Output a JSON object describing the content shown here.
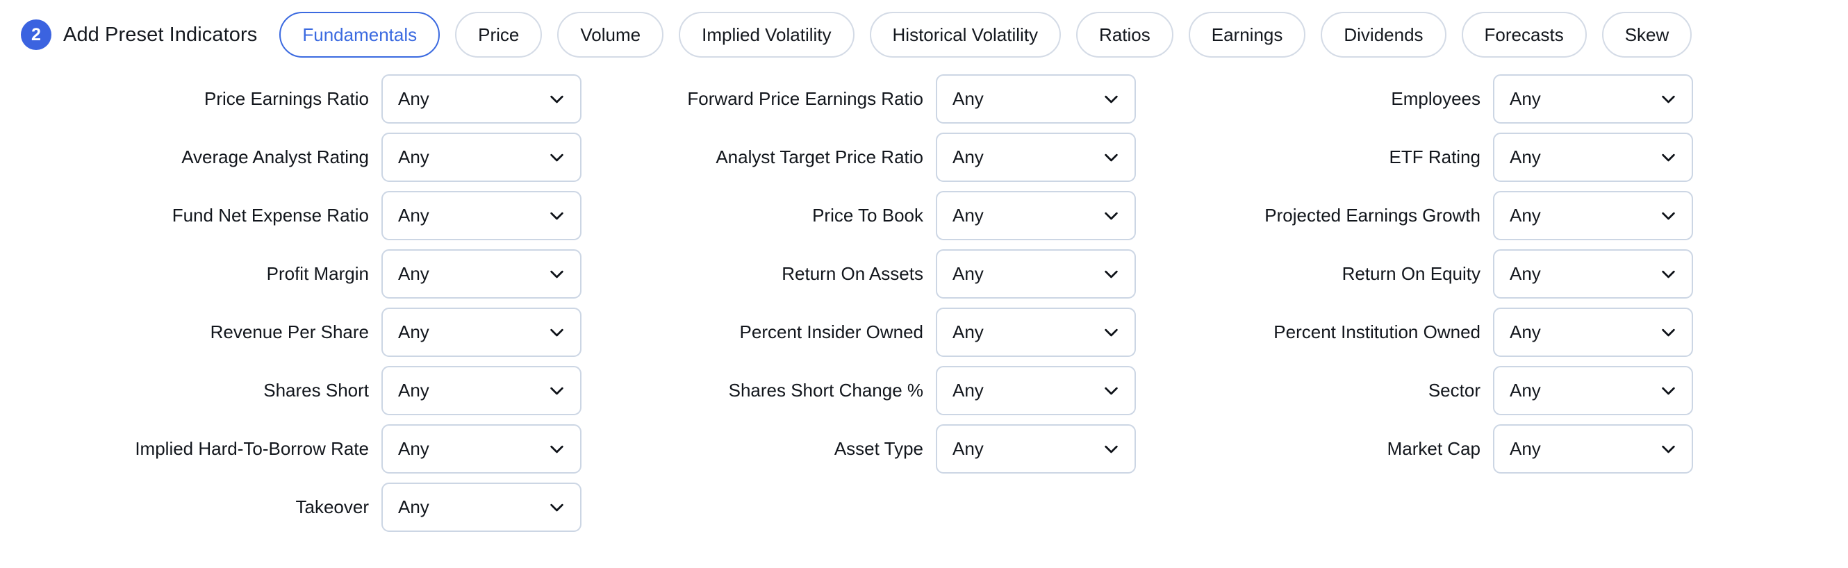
{
  "header": {
    "step_number": "2",
    "title": "Add Preset Indicators",
    "accent_color": "#3b63e0",
    "active_tab_color": "#3b6ae0",
    "tabs": [
      {
        "label": "Fundamentals",
        "active": true
      },
      {
        "label": "Price",
        "active": false
      },
      {
        "label": "Volume",
        "active": false
      },
      {
        "label": "Implied Volatility",
        "active": false
      },
      {
        "label": "Historical Volatility",
        "active": false
      },
      {
        "label": "Ratios",
        "active": false
      },
      {
        "label": "Earnings",
        "active": false
      },
      {
        "label": "Dividends",
        "active": false
      },
      {
        "label": "Forecasts",
        "active": false
      },
      {
        "label": "Skew",
        "active": false
      }
    ]
  },
  "filters": {
    "default_value": "Any",
    "columns": [
      {
        "rows": [
          {
            "label": "Price Earnings Ratio",
            "value": "Any"
          },
          {
            "label": "Average Analyst Rating",
            "value": "Any"
          },
          {
            "label": "Fund Net Expense Ratio",
            "value": "Any"
          },
          {
            "label": "Profit Margin",
            "value": "Any"
          },
          {
            "label": "Revenue Per Share",
            "value": "Any"
          },
          {
            "label": "Shares Short",
            "value": "Any"
          },
          {
            "label": "Implied Hard-To-Borrow Rate",
            "value": "Any"
          },
          {
            "label": "Takeover",
            "value": "Any"
          }
        ]
      },
      {
        "rows": [
          {
            "label": "Forward Price Earnings Ratio",
            "value": "Any"
          },
          {
            "label": "Analyst Target Price Ratio",
            "value": "Any"
          },
          {
            "label": "Price To Book",
            "value": "Any"
          },
          {
            "label": "Return On Assets",
            "value": "Any"
          },
          {
            "label": "Percent Insider Owned",
            "value": "Any"
          },
          {
            "label": "Shares Short Change %",
            "value": "Any"
          },
          {
            "label": "Asset Type",
            "value": "Any"
          }
        ]
      },
      {
        "rows": [
          {
            "label": "Employees",
            "value": "Any"
          },
          {
            "label": "ETF Rating",
            "value": "Any"
          },
          {
            "label": "Projected Earnings Growth",
            "value": "Any"
          },
          {
            "label": "Return On Equity",
            "value": "Any"
          },
          {
            "label": "Percent Institution Owned",
            "value": "Any"
          },
          {
            "label": "Sector",
            "value": "Any"
          },
          {
            "label": "Market Cap",
            "value": "Any"
          }
        ]
      }
    ]
  },
  "icons": {
    "dropdown": "chevron-down-icon"
  }
}
